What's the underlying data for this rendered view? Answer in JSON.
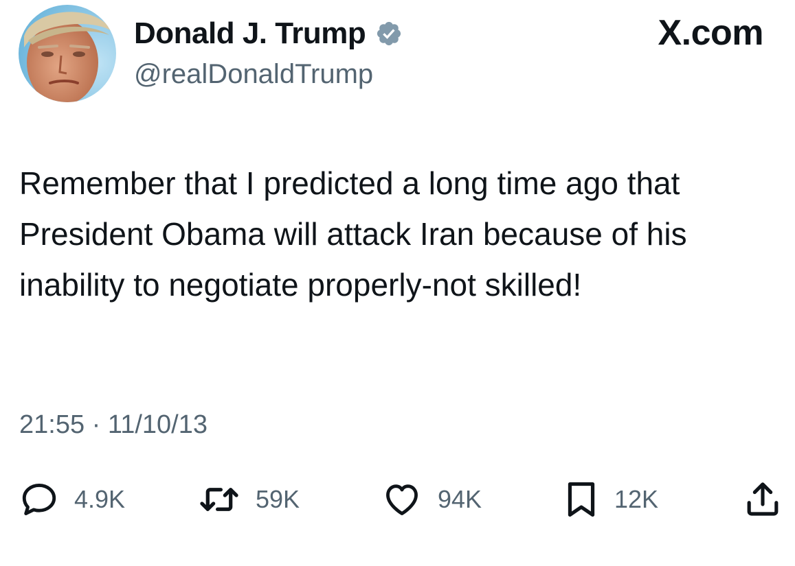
{
  "header": {
    "display_name": "Donald J. Trump",
    "handle": "@realDonaldTrump",
    "site": "X.com"
  },
  "icons": {
    "avatar": "profile-photo",
    "verified": "verified-badge-icon",
    "reply": "reply-icon",
    "retweet": "retweet-icon",
    "like": "like-icon",
    "bookmark": "bookmark-icon",
    "share": "share-icon"
  },
  "tweet": {
    "text": "Remember that I predicted a long time ago that President Obama will attack Iran because of his inability to negotiate properly-not skilled!",
    "time": "21:55",
    "separator": "·",
    "date": "11/10/13"
  },
  "stats": {
    "replies": "4.9K",
    "retweets": "59K",
    "likes": "94K",
    "bookmarks": "12K"
  },
  "colors": {
    "text": "#0f1419",
    "secondary": "#536471",
    "verified": "#829aab"
  }
}
